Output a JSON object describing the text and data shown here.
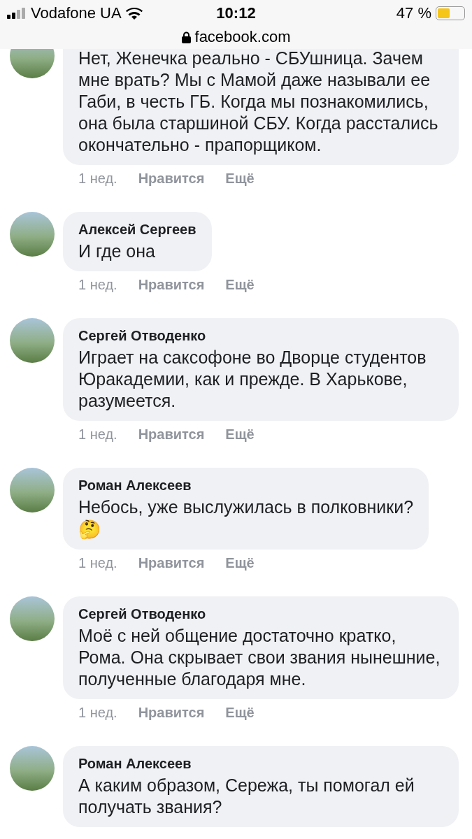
{
  "status_bar": {
    "carrier": "Vodafone UA",
    "time": "10:12",
    "battery_percent": "47 %",
    "url": "facebook.com"
  },
  "comments": [
    {
      "text": "Нет, Женечка реально - СБУшница. Зачем мне врать? Мы с Мамой даже называли ее Габи, в честь ГБ. Когда мы познакомились, она была старшиной СБУ. Когда расстались окончательно - прапорщиком.",
      "time": "1 нед.",
      "actions": [
        "Нравится",
        "Ещё"
      ]
    },
    {
      "author": "Алексей Сергеев",
      "text": "И где она",
      "time": "1 нед.",
      "actions": [
        "Нравится",
        "Ещё"
      ]
    },
    {
      "author": "Сергей Отводенко",
      "text": "Играет на саксофоне во Дворце студентов Юракадемии, как и прежде. В Харькове, разумеется.",
      "time": "1 нед.",
      "actions": [
        "Нравится",
        "Ещё"
      ]
    },
    {
      "author": "Роман Алексеев",
      "text": "Небось, уже выслужилась в полковники?",
      "emoji": "🤔",
      "time": "1 нед.",
      "actions": [
        "Нравится",
        "Ещё"
      ]
    },
    {
      "author": "Сергей Отводенко",
      "text": "Моё с ней общение достаточно кратко, Рома. Она скрывает свои звания нынешние, полученные благодаря мне.",
      "time": "1 нед.",
      "actions": [
        "Нравится",
        "Ещё"
      ]
    },
    {
      "author": "Роман Алексеев",
      "text": "А каким образом, Сережа, ты помогал ей получать звания?"
    }
  ]
}
